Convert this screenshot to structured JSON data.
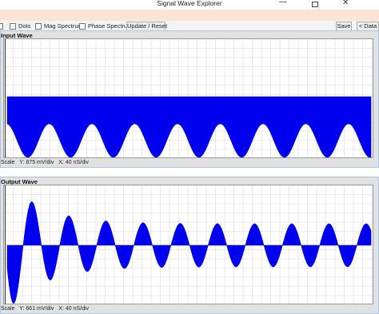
{
  "window": {
    "title": "Signal Wave Explorer",
    "min_glyph": "—",
    "close_glyph": "✕"
  },
  "toolbar": {
    "dots_label": "Dots",
    "mag_label": "Mag Spectrum",
    "phase_label": "Phase Spectrum",
    "update_label": "Update / Reset",
    "save_label": "Save",
    "back_label": "< Data"
  },
  "input_panel": {
    "title": "Input Wave",
    "scale_prefix": "Scale",
    "y_scale": "Y: 875 mV/div",
    "x_scale": "X: 40 nS/div"
  },
  "output_panel": {
    "title": "Output Wave",
    "scale_prefix": "Scale",
    "y_scale": "Y: 661 mV/div",
    "x_scale": "X: 40 nS/div"
  },
  "colors": {
    "wave": "#0000ee",
    "grid": "#d9d9d9",
    "accent": "#fbe4d5",
    "panel_border": "#a9c7e8"
  }
}
